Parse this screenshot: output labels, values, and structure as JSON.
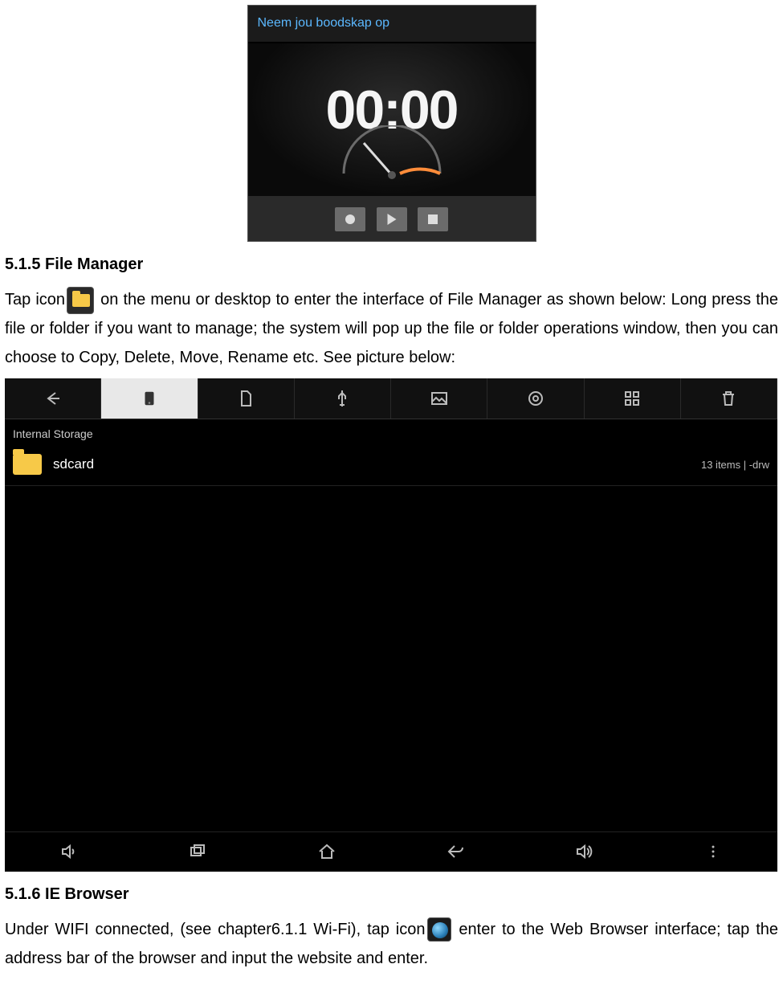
{
  "recorder": {
    "title": "Neem jou boodskap op",
    "time": "00:00",
    "buttons": {
      "record": "record",
      "play": "play",
      "stop": "stop"
    },
    "icons": {
      "record": "record-circle-icon",
      "play": "play-icon",
      "stop": "stop-icon"
    }
  },
  "section_fm": {
    "heading": "5.1.5 File Manager",
    "text_before_icon": "Tap icon",
    "text_after_icon": " on the menu or desktop to enter the interface of File Manager as shown below: Long press the file or folder if you want to   manage; the system will pop up the file or folder operations window, then you can choose to Copy, Delete, Move, Rename etc. See picture below:"
  },
  "fm_shot": {
    "breadcrumb": "Internal Storage",
    "folder": "sdcard",
    "meta": "13 items | -drw",
    "topbar_icons": [
      "back-arrow-icon",
      "device-icon",
      "sd-card-icon",
      "usb-icon",
      "image-icon",
      "video-icon",
      "grid-icon",
      "trash-icon"
    ],
    "navbar_icons": [
      "volume-down-icon",
      "recent-apps-icon",
      "home-icon",
      "back-icon",
      "volume-up-icon",
      "menu-dots-icon"
    ]
  },
  "section_br": {
    "heading": "5.1.6 IE Browser",
    "text_before_icon": "Under WIFI connected, (see chapter6.1.1 Wi-Fi), tap icon",
    "text_after_icon": " enter to the Web Browser interface; tap the address bar of the browser and input the website and enter."
  }
}
